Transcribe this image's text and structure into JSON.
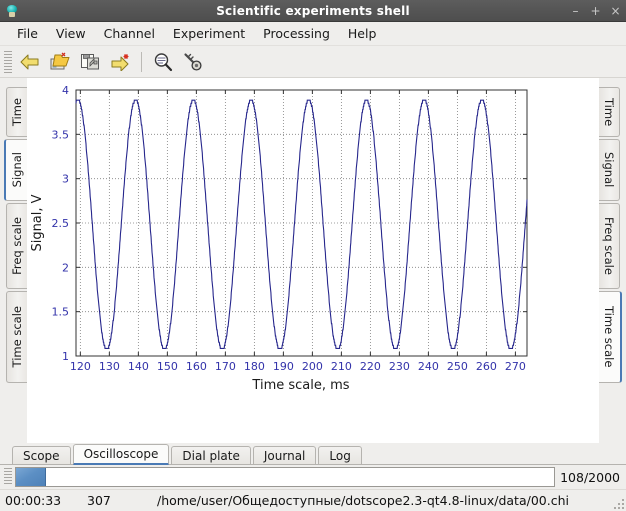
{
  "window": {
    "title": "Scientific experiments shell",
    "icon": "lamp-icon",
    "controls": [
      {
        "name": "minimize-button",
        "glyph": "–"
      },
      {
        "name": "maximize-button",
        "glyph": "+"
      },
      {
        "name": "close-button",
        "glyph": "×"
      }
    ]
  },
  "menubar": {
    "items": [
      {
        "label": "File"
      },
      {
        "label": "View"
      },
      {
        "label": "Channel"
      },
      {
        "label": "Experiment"
      },
      {
        "label": "Processing"
      },
      {
        "label": "Help"
      }
    ]
  },
  "toolbar": {
    "buttons": [
      {
        "name": "back-arrow-icon",
        "title": "Back"
      },
      {
        "name": "open-folder-icon",
        "title": "Open"
      },
      {
        "name": "save-copy-icon",
        "title": "Save"
      },
      {
        "name": "forward-arrow-new-icon",
        "title": "Next"
      },
      {
        "name": "magnifier-icon",
        "title": "Zoom"
      },
      {
        "name": "key-icon",
        "title": "Settings"
      }
    ]
  },
  "left_tabs": {
    "items": [
      {
        "label": "Time",
        "selected": false
      },
      {
        "label": "Signal",
        "selected": true
      },
      {
        "label": "Freq scale",
        "selected": false
      },
      {
        "label": "Time scale",
        "selected": false
      }
    ]
  },
  "right_tabs": {
    "items": [
      {
        "label": "Time",
        "selected": false
      },
      {
        "label": "Signal",
        "selected": false
      },
      {
        "label": "Freq scale",
        "selected": false
      },
      {
        "label": "Time scale",
        "selected": true
      }
    ]
  },
  "bottom_tabs": {
    "items": [
      {
        "label": "Scope",
        "selected": false
      },
      {
        "label": "Oscilloscope",
        "selected": true
      },
      {
        "label": "Dial plate",
        "selected": false
      },
      {
        "label": "Journal",
        "selected": false
      },
      {
        "label": "Log",
        "selected": false
      }
    ]
  },
  "progress": {
    "value": 108,
    "max": 2000,
    "percent": 5.4,
    "counter_text": "108/2000"
  },
  "statusbar": {
    "elapsed": "00:00:33",
    "count": "307",
    "path": "/home/user/Общедоступные/dotscope2.3-qt4.8-linux/data/00.chi"
  },
  "colors": {
    "trace": "#26268c",
    "tick_label": "#3333aa",
    "axis": "#333333",
    "grid": "#808080",
    "accent": "#4a7ab5",
    "plot_bg": "#ffffff",
    "chrome_bg": "#efeeec",
    "titlebar_bg": "#555555"
  },
  "chart_data": {
    "type": "line",
    "title": "",
    "xlabel": "Time scale, ms",
    "ylabel": "Signal, V",
    "xlim": [
      118.5,
      274.0
    ],
    "ylim": [
      1.0,
      4.0
    ],
    "xticks": [
      120,
      130,
      140,
      150,
      160,
      170,
      180,
      190,
      200,
      210,
      220,
      230,
      240,
      250,
      260,
      270
    ],
    "yticks": [
      1,
      1.5,
      2,
      2.5,
      3,
      3.5,
      4
    ],
    "xtick_labels": [
      "120",
      "130",
      "140",
      "150",
      "160",
      "170",
      "180",
      "190",
      "200",
      "210",
      "220",
      "230",
      "240",
      "250",
      "260",
      "270"
    ],
    "ytick_labels": [
      "1",
      "1.5",
      "2",
      "2.5",
      "3",
      "3.5",
      "4"
    ],
    "grid": true,
    "legend": false,
    "series": [
      {
        "name": "Signal",
        "color": "#26268c",
        "waveform": "sine",
        "amplitude": 1.41,
        "offset": 2.48,
        "period_ms": 19.9,
        "phase_deg": 78,
        "quantization_step": 0.035,
        "peaks_x": [
          118.5,
          138.3,
          158.2,
          178.1,
          198.0,
          217.9,
          237.8,
          257.7
        ],
        "peaks_y": 3.89,
        "troughs_x": [
          128.4,
          148.3,
          168.2,
          188.1,
          208.0,
          227.9,
          247.8,
          267.7
        ],
        "troughs_y": 1.07
      }
    ]
  }
}
